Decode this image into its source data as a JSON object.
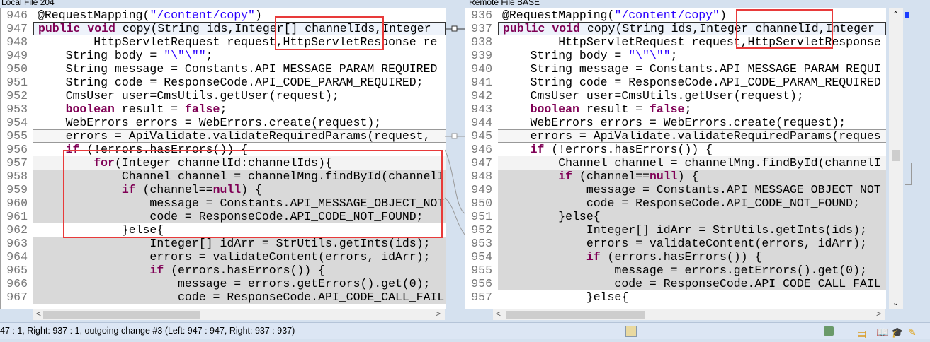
{
  "left": {
    "title": "Local File 204",
    "lines": [
      {
        "num": "946",
        "text": "@RequestMapping(\"/content/copy\")"
      },
      {
        "num": "947",
        "text": "public void copy(String ids,Integer[] channelIds,Integer ",
        "state": "current"
      },
      {
        "num": "948",
        "text": "        HttpServletRequest request,HttpServletResponse re"
      },
      {
        "num": "949",
        "text": "    String body = \"\\\"\\\"\";"
      },
      {
        "num": "950",
        "text": "    String message = Constants.API_MESSAGE_PARAM_REQUIRED"
      },
      {
        "num": "951",
        "text": "    String code = ResponseCode.API_CODE_PARAM_REQUIRED;"
      },
      {
        "num": "952",
        "text": "    CmsUser user=CmsUtils.getUser(request);"
      },
      {
        "num": "953",
        "text": "    boolean result = false;"
      },
      {
        "num": "954",
        "text": "    WebErrors errors = WebErrors.create(request);"
      },
      {
        "num": "955",
        "text": "    errors = ApiValidate.validateRequiredParams(request, ",
        "state": "boxed"
      },
      {
        "num": "956",
        "text": "    if (!errors.hasErrors()) {"
      },
      {
        "num": "957",
        "text": "        for(Integer channelId:channelIds){",
        "state": "soft"
      },
      {
        "num": "958",
        "text": "            Channel channel = channelMng.findById(channelI",
        "state": "changed"
      },
      {
        "num": "959",
        "text": "            if (channel==null) {",
        "state": "changed"
      },
      {
        "num": "960",
        "text": "                message = Constants.API_MESSAGE_OBJECT_NOT",
        "state": "changed"
      },
      {
        "num": "961",
        "text": "                code = ResponseCode.API_CODE_NOT_FOUND;",
        "state": "changed"
      },
      {
        "num": "962",
        "text": "            }else{"
      },
      {
        "num": "963",
        "text": "                Integer[] idArr = StrUtils.getInts(ids);",
        "state": "changed"
      },
      {
        "num": "964",
        "text": "                errors = validateContent(errors, idArr);",
        "state": "changed"
      },
      {
        "num": "965",
        "text": "                if (errors.hasErrors()) {",
        "state": "changed"
      },
      {
        "num": "966",
        "text": "                    message = errors.getErrors().get(0);",
        "state": "changed"
      },
      {
        "num": "967",
        "text": "                    code = ResponseCode.API_CODE_CALL_FAIL",
        "state": "changed"
      }
    ]
  },
  "right": {
    "title": "Remote File BASE",
    "lines": [
      {
        "num": "936",
        "text": "@RequestMapping(\"/content/copy\")"
      },
      {
        "num": "937",
        "text": "public void copy(String ids,Integer channelId,Integer ",
        "state": "current"
      },
      {
        "num": "938",
        "text": "        HttpServletRequest request,HttpServletResponse"
      },
      {
        "num": "939",
        "text": "    String body = \"\\\"\\\"\";"
      },
      {
        "num": "940",
        "text": "    String message = Constants.API_MESSAGE_PARAM_REQUI"
      },
      {
        "num": "941",
        "text": "    String code = ResponseCode.API_CODE_PARAM_REQUIRED"
      },
      {
        "num": "942",
        "text": "    CmsUser user=CmsUtils.getUser(request);"
      },
      {
        "num": "943",
        "text": "    boolean result = false;"
      },
      {
        "num": "944",
        "text": "    WebErrors errors = WebErrors.create(request);"
      },
      {
        "num": "945",
        "text": "    errors = ApiValidate.validateRequiredParams(reques",
        "state": "boxed"
      },
      {
        "num": "946",
        "text": "    if (!errors.hasErrors()) {"
      },
      {
        "num": "947",
        "text": "        Channel channel = channelMng.findById(channelI",
        "state": "soft"
      },
      {
        "num": "948",
        "text": "        if (channel==null) {",
        "state": "changed"
      },
      {
        "num": "949",
        "text": "            message = Constants.API_MESSAGE_OBJECT_NOT_",
        "state": "changed"
      },
      {
        "num": "950",
        "text": "            code = ResponseCode.API_CODE_NOT_FOUND;",
        "state": "changed"
      },
      {
        "num": "951",
        "text": "        }else{",
        "state": "changed"
      },
      {
        "num": "952",
        "text": "            Integer[] idArr = StrUtils.getInts(ids);",
        "state": "changed"
      },
      {
        "num": "953",
        "text": "            errors = validateContent(errors, idArr);",
        "state": "changed"
      },
      {
        "num": "954",
        "text": "            if (errors.hasErrors()) {",
        "state": "changed"
      },
      {
        "num": "955",
        "text": "                message = errors.getErrors().get(0);",
        "state": "changed"
      },
      {
        "num": "956",
        "text": "                code = ResponseCode.API_CODE_CALL_FAIL",
        "state": "changed"
      },
      {
        "num": "957",
        "text": "            }else{"
      }
    ]
  },
  "status": {
    "text": "47 : 1, Right: 937 : 1, outgoing change #3 (Left: 947 : 947, Right: 937 : 937)"
  },
  "colors": {
    "keyword": "#7f0055",
    "string": "#2a00ff",
    "annotation_box": "#e83a3a",
    "changed_bg": "#d9d9d9"
  },
  "icons": [
    "scroll-left-icon",
    "scroll-right-icon",
    "scroll-up-icon",
    "scroll-down-icon",
    "sync-icon",
    "status-icon",
    "book-icon",
    "hat-icon",
    "pencil-icon"
  ]
}
